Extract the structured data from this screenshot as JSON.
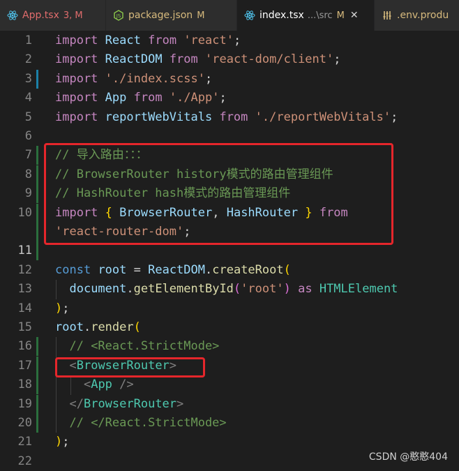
{
  "tabs": [
    {
      "label": "App.tsx",
      "status": "3, M",
      "icon": "react-icon"
    },
    {
      "label": "package.json",
      "status": "M",
      "icon": "nodejs-icon"
    },
    {
      "label": "index.tsx",
      "sub": "...\\src",
      "status": "M",
      "icon": "react-icon",
      "active": true
    },
    {
      "label": ".env.produ",
      "icon": "settings-icon"
    }
  ],
  "lines": [
    {
      "n": "1",
      "t": [
        [
          "kw",
          "import"
        ],
        [
          "pun",
          " "
        ],
        [
          "var",
          "React"
        ],
        [
          "pun",
          " "
        ],
        [
          "kw",
          "from"
        ],
        [
          "pun",
          " "
        ],
        [
          "str",
          "'react'"
        ],
        [
          "pun",
          ";"
        ]
      ]
    },
    {
      "n": "2",
      "t": [
        [
          "kw",
          "import"
        ],
        [
          "pun",
          " "
        ],
        [
          "var",
          "ReactDOM"
        ],
        [
          "pun",
          " "
        ],
        [
          "kw",
          "from"
        ],
        [
          "pun",
          " "
        ],
        [
          "str",
          "'react-dom/client'"
        ],
        [
          "pun",
          ";"
        ]
      ]
    },
    {
      "n": "3",
      "t": [
        [
          "kw",
          "import"
        ],
        [
          "pun",
          " "
        ],
        [
          "str",
          "'./index.scss'"
        ],
        [
          "pun",
          ";"
        ]
      ]
    },
    {
      "n": "4",
      "t": [
        [
          "kw",
          "import"
        ],
        [
          "pun",
          " "
        ],
        [
          "var",
          "App"
        ],
        [
          "pun",
          " "
        ],
        [
          "kw",
          "from"
        ],
        [
          "pun",
          " "
        ],
        [
          "str",
          "'./App'"
        ],
        [
          "pun",
          ";"
        ]
      ]
    },
    {
      "n": "5",
      "t": [
        [
          "kw",
          "import"
        ],
        [
          "pun",
          " "
        ],
        [
          "var",
          "reportWebVitals"
        ],
        [
          "pun",
          " "
        ],
        [
          "kw",
          "from"
        ],
        [
          "pun",
          " "
        ],
        [
          "str",
          "'./reportWebVitals'"
        ],
        [
          "pun",
          ";"
        ]
      ]
    },
    {
      "n": "6",
      "t": []
    },
    {
      "n": "7",
      "t": [
        [
          "cmt",
          "// 导入路由：：："
        ]
      ]
    },
    {
      "n": "8",
      "t": [
        [
          "cmt",
          "// BrowserRouter history模式的路由管理组件"
        ]
      ]
    },
    {
      "n": "9",
      "t": [
        [
          "cmt",
          "// HashRouter hash模式的路由管理组件"
        ]
      ]
    },
    {
      "n": "10",
      "t": [
        [
          "kw",
          "import"
        ],
        [
          "pun",
          " "
        ],
        [
          "brk1",
          "{"
        ],
        [
          "pun",
          " "
        ],
        [
          "var",
          "BrowserRouter"
        ],
        [
          "pun",
          ", "
        ],
        [
          "var",
          "HashRouter"
        ],
        [
          "pun",
          " "
        ],
        [
          "brk1",
          "}"
        ],
        [
          "pun",
          " "
        ],
        [
          "kw",
          "from"
        ]
      ]
    },
    {
      "n": "",
      "t": [
        [
          "str",
          "'react-router-dom'"
        ],
        [
          "pun",
          ";"
        ]
      ]
    },
    {
      "n": "11",
      "t": []
    },
    {
      "n": "12",
      "t": [
        [
          "dec",
          "const"
        ],
        [
          "pun",
          " "
        ],
        [
          "var",
          "root"
        ],
        [
          "pun",
          " = "
        ],
        [
          "var",
          "ReactDOM"
        ],
        [
          "pun",
          "."
        ],
        [
          "fn",
          "createRoot"
        ],
        [
          "brk1",
          "("
        ]
      ]
    },
    {
      "n": "13",
      "t": [
        [
          "pun",
          "  "
        ],
        [
          "var",
          "document"
        ],
        [
          "pun",
          "."
        ],
        [
          "fn",
          "getElementById"
        ],
        [
          "brk2",
          "("
        ],
        [
          "str",
          "'root'"
        ],
        [
          "brk2",
          ")"
        ],
        [
          "pun",
          " "
        ],
        [
          "kw",
          "as"
        ],
        [
          "pun",
          " "
        ],
        [
          "ty",
          "HTMLElement"
        ]
      ]
    },
    {
      "n": "14",
      "t": [
        [
          "brk1",
          ")"
        ],
        [
          "pun",
          ";"
        ]
      ]
    },
    {
      "n": "15",
      "t": [
        [
          "var",
          "root"
        ],
        [
          "pun",
          "."
        ],
        [
          "fn",
          "render"
        ],
        [
          "brk1",
          "("
        ]
      ]
    },
    {
      "n": "16",
      "t": [
        [
          "pun",
          "  "
        ],
        [
          "cmt",
          "// <React.StrictMode>"
        ]
      ]
    },
    {
      "n": "17",
      "t": [
        [
          "pun",
          "  "
        ],
        [
          "tag",
          "<"
        ],
        [
          "tagname",
          "BrowserRouter"
        ],
        [
          "tag",
          ">"
        ]
      ]
    },
    {
      "n": "18",
      "t": [
        [
          "pun",
          "    "
        ],
        [
          "tag",
          "<"
        ],
        [
          "tagname",
          "App"
        ],
        [
          "pun",
          " "
        ],
        [
          "tag",
          "/>"
        ]
      ]
    },
    {
      "n": "19",
      "t": [
        [
          "pun",
          "  "
        ],
        [
          "tag",
          "</"
        ],
        [
          "tagname",
          "BrowserRouter"
        ],
        [
          "tag",
          ">"
        ]
      ]
    },
    {
      "n": "20",
      "t": [
        [
          "pun",
          "  "
        ],
        [
          "cmt",
          "// </React.StrictMode>"
        ]
      ]
    },
    {
      "n": "21",
      "t": [
        [
          "brk1",
          ")"
        ],
        [
          "pun",
          ";"
        ]
      ]
    },
    {
      "n": "22",
      "t": []
    }
  ],
  "watermark": "CSDN @憨憨404"
}
